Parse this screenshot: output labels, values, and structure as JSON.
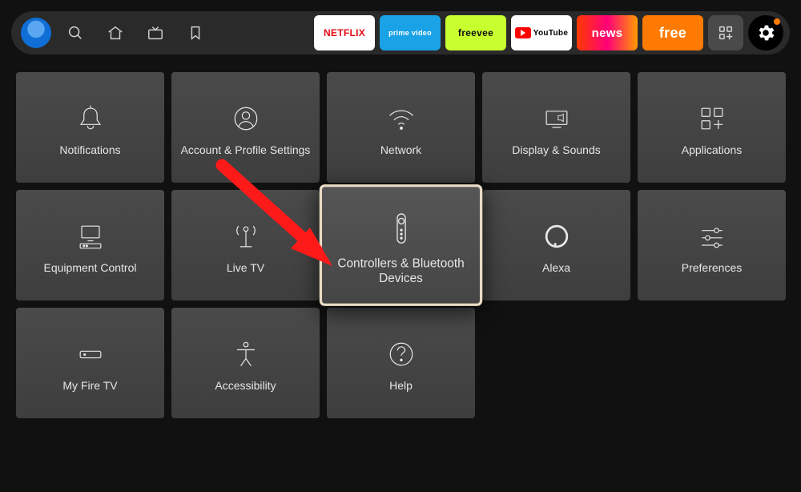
{
  "topbar": {
    "apps": [
      {
        "id": "netflix",
        "label": "NETFLIX"
      },
      {
        "id": "prime",
        "label": "prime video"
      },
      {
        "id": "freevee",
        "label": "freevee"
      },
      {
        "id": "youtube",
        "label": "YouTube"
      },
      {
        "id": "news",
        "label": "news"
      },
      {
        "id": "free",
        "label": "free"
      }
    ]
  },
  "settings": {
    "tiles": [
      {
        "id": "notifications",
        "label": "Notifications"
      },
      {
        "id": "account",
        "label": "Account & Profile Settings"
      },
      {
        "id": "network",
        "label": "Network"
      },
      {
        "id": "display",
        "label": "Display & Sounds"
      },
      {
        "id": "applications",
        "label": "Applications"
      },
      {
        "id": "equipment",
        "label": "Equipment Control"
      },
      {
        "id": "livetv",
        "label": "Live TV"
      },
      {
        "id": "controllers",
        "label": "Controllers & Bluetooth Devices",
        "selected": true
      },
      {
        "id": "alexa",
        "label": "Alexa"
      },
      {
        "id": "preferences",
        "label": "Preferences"
      },
      {
        "id": "myfiretv",
        "label": "My Fire TV"
      },
      {
        "id": "accessibility",
        "label": "Accessibility"
      },
      {
        "id": "help",
        "label": "Help"
      }
    ]
  },
  "annotation": {
    "arrow_target": "controllers"
  }
}
